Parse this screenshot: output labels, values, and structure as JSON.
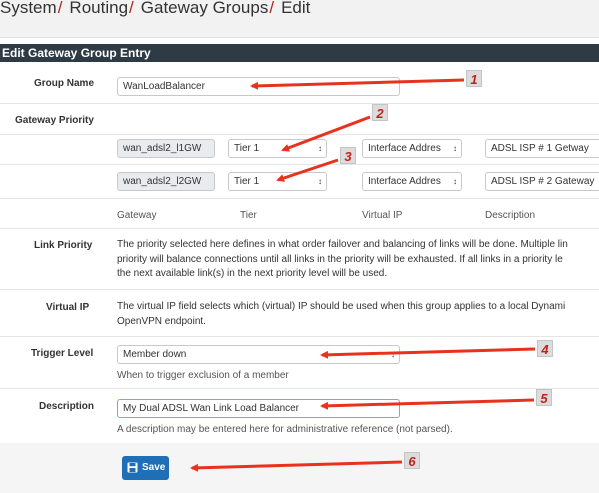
{
  "breadcrumb": {
    "items": [
      "System",
      "Routing",
      "Gateway Groups",
      "Edit"
    ],
    "separator": "/"
  },
  "panel": {
    "title": "Edit Gateway Group Entry"
  },
  "group_name": {
    "label": "Group Name",
    "value": "WanLoadBalancer"
  },
  "gateway_priority": {
    "label": "Gateway Priority",
    "rows": [
      {
        "gateway": "wan_adsl2_l1GW",
        "tier": "Tier 1",
        "virtual_ip": "Interface Addres",
        "description": "ADSL ISP # 1 Getway"
      },
      {
        "gateway": "wan_adsl2_l2GW",
        "tier": "Tier 1",
        "virtual_ip": "Interface Addres",
        "description": "ADSL ISP # 2 Gateway"
      }
    ],
    "columns": [
      "Gateway",
      "Tier",
      "Virtual IP",
      "Description"
    ]
  },
  "link_priority": {
    "label": "Link Priority",
    "lines": [
      "The priority selected here defines in what order failover and balancing of links will be done. Multiple lin",
      "priority will balance connections until all links in the priority will be exhausted. If all links in a priority le",
      "the next available link(s) in the next priority level will be used."
    ]
  },
  "virtual_ip": {
    "label": "Virtual IP",
    "lines": [
      "The virtual IP field selects which (virtual) IP should be used when this group applies to a local Dynami",
      "OpenVPN endpoint."
    ]
  },
  "trigger_level": {
    "label": "Trigger Level",
    "value": "Member down",
    "help": "When to trigger exclusion of a member"
  },
  "description": {
    "label": "Description",
    "value": "My Dual ADSL Wan Link Load Balancer",
    "help": "A description may be entered here for administrative reference (not parsed)."
  },
  "save_button": {
    "label": "Save",
    "icon": "save-icon"
  },
  "callouts": [
    "1",
    "2",
    "3",
    "4",
    "5",
    "6"
  ],
  "colors": {
    "accent_arrow": "#e8321e",
    "header_bar": "#2e3a44",
    "button": "#1e6fb6",
    "breadcrumb_sep": "#b5211e"
  }
}
